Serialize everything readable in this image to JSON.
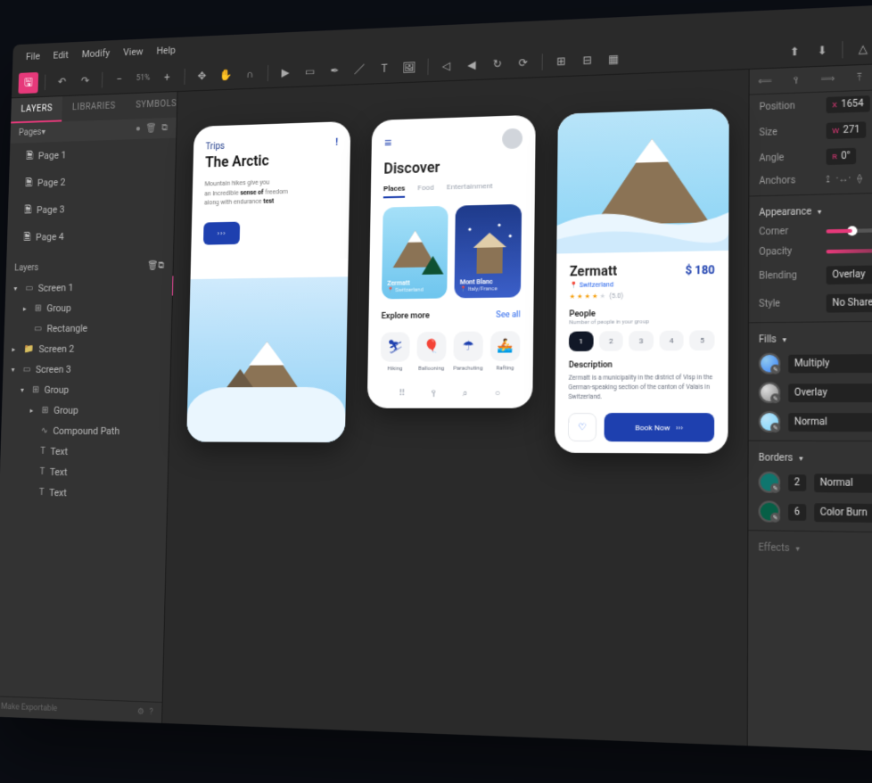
{
  "menu": {
    "file": "File",
    "edit": "Edit",
    "modify": "Modify",
    "view": "View",
    "help": "Help"
  },
  "toolbar": {
    "zoom": "51%"
  },
  "left": {
    "tabs": {
      "layers": "LAYERS",
      "libraries": "LIBRARIES",
      "symbols": "SYMBOLS"
    },
    "pages_label": "Pages",
    "pages": [
      "Page 1",
      "Page 2",
      "Page 3",
      "Page 4"
    ],
    "layers_label": "Layers",
    "tree": {
      "screen1": "Screen 1",
      "group": "Group",
      "rectangle": "Rectangle",
      "screen2": "Screen 2",
      "screen3": "Screen 3",
      "group3": "Group",
      "group3b": "Group",
      "compound": "Compound Path",
      "text1": "Text",
      "text2": "Text",
      "text3": "Text"
    },
    "export": "Make Exportable"
  },
  "canvas": {
    "p1": {
      "kicker": "Trips",
      "title": "The Arctic",
      "desc1": "Mountain hikes give you",
      "desc2a": "an incredible ",
      "desc2b": "sense of",
      "desc2c": " freedom",
      "desc3a": "along with endurance ",
      "desc3b": "test",
      "cta": "›››"
    },
    "p2": {
      "title": "Discover",
      "tab_places": "Places",
      "tab_food": "Food",
      "tab_ent": "Entertainment",
      "card1_name": "Zermatt",
      "card1_loc": "Switzerland",
      "card2_name": "Mont Blanc",
      "card2_loc": "Italy/France",
      "explore": "Explore more",
      "see_all": "See all",
      "act1": "Hiking",
      "act2": "Ballooning",
      "act3": "Parachuting",
      "act4": "Rafting"
    },
    "p3": {
      "name": "Zermatt",
      "price": "$ 180",
      "loc": "Switzerland",
      "rating": "(5.0)",
      "people_h": "People",
      "people_s": "Number of people in your group",
      "pills": [
        "1",
        "2",
        "3",
        "4",
        "5"
      ],
      "desc_h": "Description",
      "desc": "Zermatt is a municipality in the district of Visp in the German-speaking section of the canton of Valais in Switzerland.",
      "book": "Book Now",
      "book_arrows": "›››"
    }
  },
  "right": {
    "position": "Position",
    "pos_x_axis": "X",
    "pos_x_val": "1654",
    "size": "Size",
    "size_w_axis": "W",
    "size_w_val": "271",
    "angle": "Angle",
    "angle_axis": "R",
    "angle_val": "0°",
    "anchors": "Anchors",
    "appearance": "Appearance",
    "corner": "Corner",
    "opacity": "Opacity",
    "blending": "Blending",
    "blending_val": "Overlay",
    "style": "Style",
    "style_val": "No Shared Style",
    "fills": "Fills",
    "fill1_mode": "Multiply",
    "fill2_mode": "Overlay",
    "fill3_mode": "Normal",
    "borders": "Borders",
    "border1_w": "2",
    "border1_mode": "Normal",
    "border2_w": "6",
    "border2_mode": "Color Burn",
    "effects": "Effects"
  }
}
